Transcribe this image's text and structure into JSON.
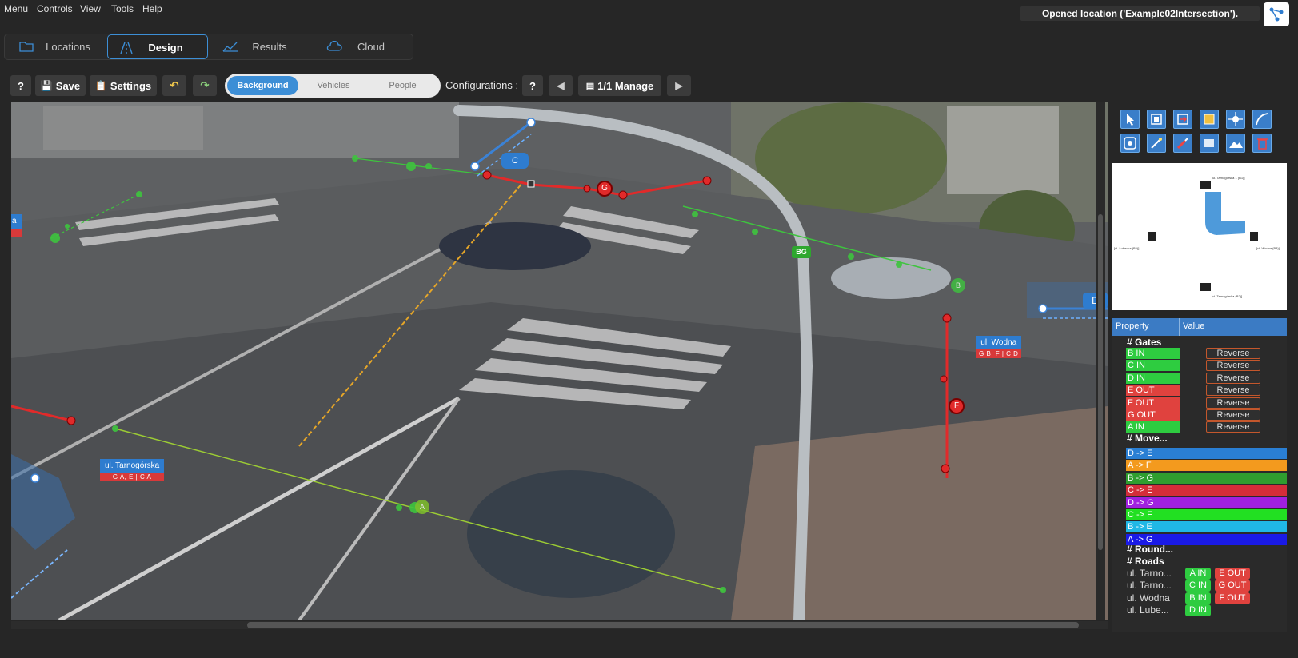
{
  "menubar": {
    "items": [
      "Menu",
      "Controls",
      "View",
      "Tools",
      "Help"
    ],
    "status": "Opened location ('Example02Intersection')."
  },
  "main_tabs": [
    {
      "label": "Locations",
      "icon": "folder-icon",
      "active": false
    },
    {
      "label": "Design",
      "icon": "road-icon",
      "active": true
    },
    {
      "label": "Results",
      "icon": "chart-icon",
      "active": false
    },
    {
      "label": "Cloud",
      "icon": "cloud-icon",
      "active": false
    }
  ],
  "toolbar": {
    "help_label": "?",
    "save_label": "Save",
    "settings_label": "Settings",
    "layers": [
      "Background",
      "Vehicles",
      "People"
    ],
    "active_layer": "Background",
    "configurations_label": "Configurations :",
    "config_help_label": "?",
    "manage_label": "1/1 Manage"
  },
  "canvas": {
    "gate_markers": [
      "C",
      "G",
      "BG",
      "B",
      "F",
      "A",
      "D"
    ],
    "edge_label": "a",
    "road_labels": [
      {
        "name": "ul. Wodna",
        "gates": "G B, F | C D"
      },
      {
        "name": "ul. Tarnogórska",
        "gates": "G A, E | C A"
      }
    ]
  },
  "minimap": {
    "labels": [
      "[ul. Tarnogórska 1 (B1)]",
      "[ul. Lubecka (B5)]",
      "[ul. Wodna (B3)]",
      "[ul. Tarnogórska (B2)]"
    ]
  },
  "properties": {
    "col_property": "Property",
    "col_value": "Value",
    "gates_header": "# Gates",
    "reverse_label": "Reverse",
    "gates": [
      {
        "label": "B IN",
        "color": "#2ecc40"
      },
      {
        "label": "C IN",
        "color": "#2ecc40"
      },
      {
        "label": "D IN",
        "color": "#2ecc40"
      },
      {
        "label": "E OUT",
        "color": "#e0423e"
      },
      {
        "label": "F OUT",
        "color": "#e0423e"
      },
      {
        "label": "G OUT",
        "color": "#e0423e"
      },
      {
        "label": "A IN",
        "color": "#2ecc40"
      }
    ],
    "movements_header": "# Move...",
    "movements": [
      {
        "label": "D -> E",
        "color": "#2a7fd4"
      },
      {
        "label": "A -> F",
        "color": "#f39a1e"
      },
      {
        "label": "B -> G",
        "color": "#2f9e2f"
      },
      {
        "label": "C -> E",
        "color": "#d42d3a"
      },
      {
        "label": "D -> G",
        "color": "#a020e0"
      },
      {
        "label": "C -> F",
        "color": "#22e022"
      },
      {
        "label": "B -> E",
        "color": "#20b8e6"
      },
      {
        "label": "A -> G",
        "color": "#1a1ae6"
      }
    ],
    "roundabouts_header": "# Round...",
    "roads_header": "# Roads",
    "roads": [
      {
        "name": "ul. Tarno...",
        "in": "A IN",
        "out": "E OUT"
      },
      {
        "name": "ul. Tarno...",
        "in": "C IN",
        "out": "G OUT"
      },
      {
        "name": "ul. Wodna",
        "in": "B IN",
        "out": "F OUT"
      },
      {
        "name": "ul. Lube...",
        "in": "D IN",
        "out": ""
      }
    ],
    "in_color": "#2ecc40",
    "out_color": "#e0423e"
  }
}
